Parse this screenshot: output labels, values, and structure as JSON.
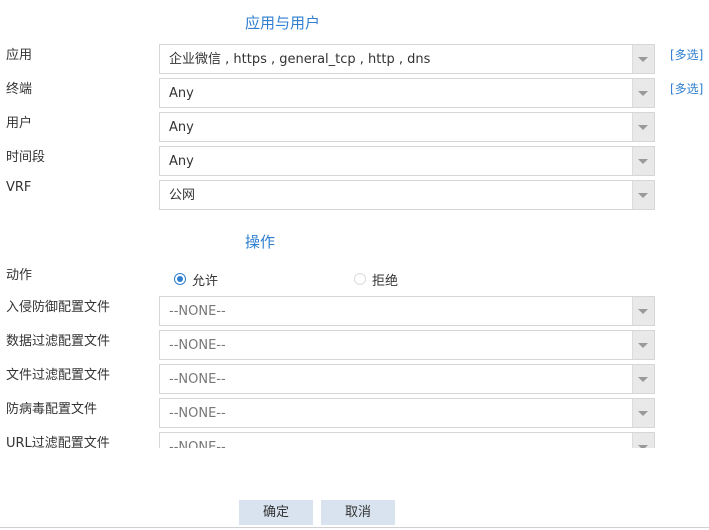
{
  "sections": {
    "app_user_title": "应用与用户",
    "action_title": "操作"
  },
  "fields": {
    "app": {
      "label": "应用",
      "value": "企业微信 , https , general_tcp , http , dns",
      "multi": "[多选]"
    },
    "terminal": {
      "label": "终端",
      "value": "Any",
      "multi": "[多选]"
    },
    "user": {
      "label": "用户",
      "value": "Any"
    },
    "time_range": {
      "label": "时间段",
      "value": "Any"
    },
    "vrf": {
      "label": "VRF",
      "value": "公网"
    }
  },
  "action": {
    "label": "动作",
    "options": [
      {
        "label": "允许",
        "checked": true
      },
      {
        "label": "拒绝",
        "checked": false
      }
    ]
  },
  "profiles": {
    "ips": {
      "label": "入侵防御配置文件",
      "value": "--NONE--"
    },
    "data_filter": {
      "label": "数据过滤配置文件",
      "value": "--NONE--"
    },
    "file_filter": {
      "label": "文件过滤配置文件",
      "value": "--NONE--"
    },
    "antivirus": {
      "label": "防病毒配置文件",
      "value": "--NONE--"
    },
    "url_filter": {
      "label": "URL过滤配置文件",
      "value": "--NONE--"
    }
  },
  "buttons": {
    "ok": "确定",
    "cancel": "取消"
  },
  "colors": {
    "accent": "#2f7fd0",
    "button_bg": "#d9e3f0",
    "arrow_box": "#e9e9e9"
  }
}
